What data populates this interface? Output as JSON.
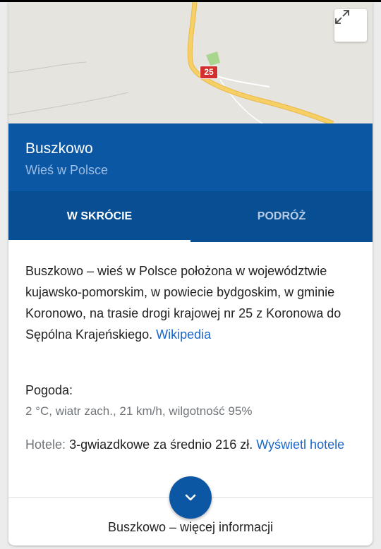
{
  "place": {
    "title": "Buszkowo",
    "subtitle": "Wieś w Polsce"
  },
  "map": {
    "route_number": "25"
  },
  "tabs": [
    {
      "label": "W SKRÓCIE",
      "active": true
    },
    {
      "label": "PODRÓŻ",
      "active": false
    }
  ],
  "overview": {
    "description": "Buszkowo – wieś w Polsce położona w województwie kujawsko-pomorskim, w powiecie bydgoskim, w gminie Koronowo, na trasie drogi krajowej nr 25 z Koronowa do Sępólna Krajeńskiego.",
    "source_link": "Wikipedia"
  },
  "weather": {
    "label": "Pogoda:",
    "value": "2 °C, wiatr zach., 21 km/h, wilgotność 95%"
  },
  "hotels": {
    "label": "Hotele:",
    "value": "3-gwiazdkowe za średnio 216 zł.",
    "link": "Wyświetl hotele"
  },
  "more_info": {
    "label": "Buszkowo – więcej informacji"
  },
  "colors": {
    "header_bg": "#0b57a4",
    "tabs_bg": "#084e92",
    "link": "#1a66c8",
    "route_badge": "#d32f2f",
    "road": "#f6cf65"
  },
  "icons": {
    "expand": "expand-icon",
    "more": "chevron-down-icon"
  }
}
